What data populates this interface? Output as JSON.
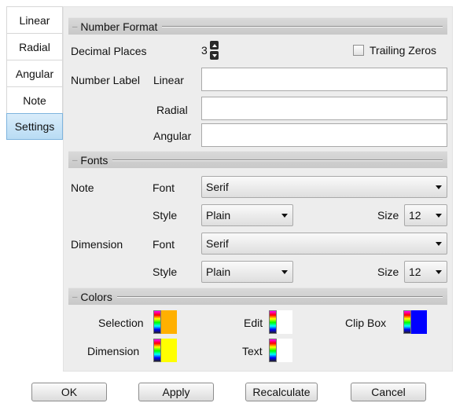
{
  "tabs": [
    {
      "label": "Linear",
      "active": false
    },
    {
      "label": "Radial",
      "active": false
    },
    {
      "label": "Angular",
      "active": false
    },
    {
      "label": "Note",
      "active": false
    },
    {
      "label": "Settings",
      "active": true
    }
  ],
  "number_format": {
    "header": "Number Format",
    "decimal_places_label": "Decimal Places",
    "decimal_places_value": "3",
    "trailing_zeros_label": "Trailing Zeros",
    "trailing_zeros_checked": false,
    "number_label": "Number Label",
    "fields": [
      {
        "label": "Linear",
        "value": ""
      },
      {
        "label": "Radial",
        "value": ""
      },
      {
        "label": "Angular",
        "value": ""
      }
    ]
  },
  "fonts": {
    "header": "Fonts",
    "font_label": "Font",
    "style_label": "Style",
    "size_label": "Size",
    "groups": [
      {
        "name": "Note",
        "font": "Serif",
        "style": "Plain",
        "size": "12"
      },
      {
        "name": "Dimension",
        "font": "Serif",
        "style": "Plain",
        "size": "12"
      }
    ]
  },
  "colors": {
    "header": "Colors",
    "items": [
      {
        "label": "Selection",
        "color": "#ffb000"
      },
      {
        "label": "Edit",
        "color": "#ffffff"
      },
      {
        "label": "Clip Box",
        "color": "#0000ff"
      },
      {
        "label": "Dimension",
        "color": "#ffff00"
      },
      {
        "label": "Text",
        "color": "#ffffff"
      }
    ]
  },
  "buttons": {
    "ok": "OK",
    "apply": "Apply",
    "recalculate": "Recalculate",
    "cancel": "Cancel"
  }
}
